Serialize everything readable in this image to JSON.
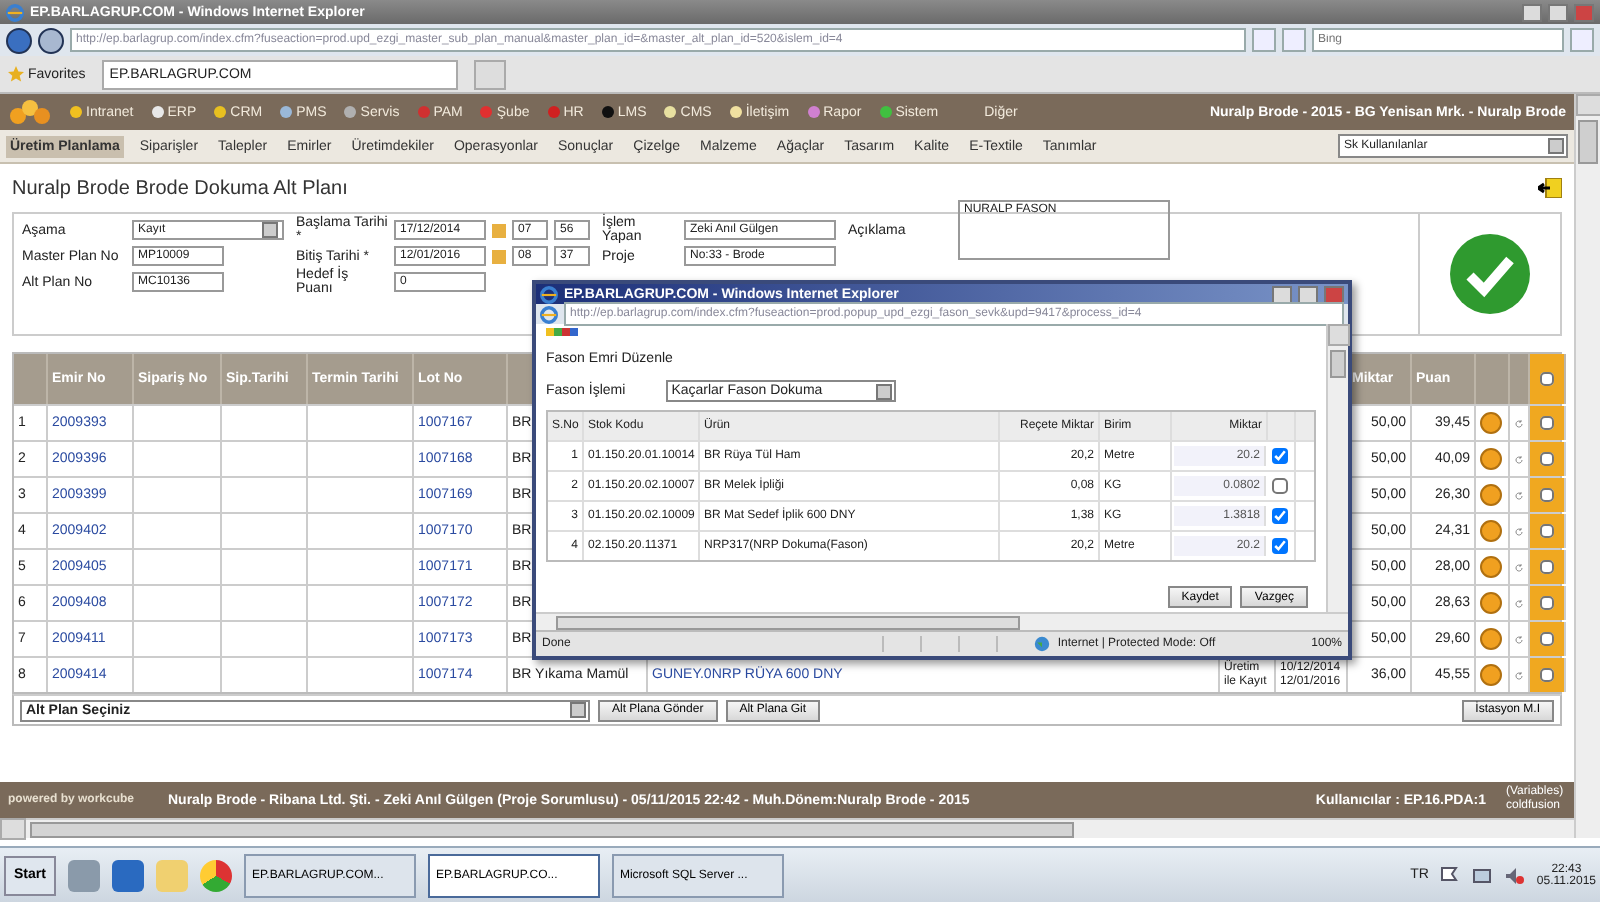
{
  "browser": {
    "title": "EP.BARLAGRUP.COM - Windows Internet Explorer",
    "url": "http://ep.barlagrup.com/index.cfm?fuseaction=prod.upd_ezgi_master_sub_plan_manual&master_plan_id=&master_alt_plan_id=520&islem_id=4",
    "search_placeholder": "Bing",
    "favorites": "Favorites",
    "tab": "EP.BARLAGRUP.COM"
  },
  "modules": [
    {
      "label": "Intranet",
      "color": "#f0c020"
    },
    {
      "label": "ERP",
      "color": "#e8e8e8"
    },
    {
      "label": "CRM",
      "color": "#e8c020"
    },
    {
      "label": "PMS",
      "color": "#9ab8d8"
    },
    {
      "label": "Servis",
      "color": "#b0b0b0"
    },
    {
      "label": "PAM",
      "color": "#d03030"
    },
    {
      "label": "Şube",
      "color": "#e03030"
    },
    {
      "label": "HR",
      "color": "#d02020"
    },
    {
      "label": "LMS",
      "color": "#101010"
    },
    {
      "label": "CMS",
      "color": "#e8e0a0"
    },
    {
      "label": "İletişim",
      "color": "#f0e0a0"
    },
    {
      "label": "Rapor",
      "color": "#d080d0"
    },
    {
      "label": "Sistem",
      "color": "#40c040"
    }
  ],
  "module_more": "Diğer",
  "session": "Nuralp Brode - 2015 - BG Yenisan Mrk. - Nuralp Brode",
  "menu": [
    {
      "label": "Üretim Planlama",
      "selected": true
    },
    {
      "label": "Siparişler",
      "selected": false
    },
    {
      "label": "Talepler",
      "selected": false
    },
    {
      "label": "Emirler",
      "selected": false
    },
    {
      "label": "Üretimdekiler",
      "selected": false
    },
    {
      "label": "Operasyonlar",
      "selected": false
    },
    {
      "label": "Sonuçlar",
      "selected": false
    },
    {
      "label": "Çizelge",
      "selected": false
    },
    {
      "label": "Malzeme",
      "selected": false
    },
    {
      "label": "Ağaçlar",
      "selected": false
    },
    {
      "label": "Tasarım",
      "selected": false
    },
    {
      "label": "Kalite",
      "selected": false
    },
    {
      "label": "E-Textile",
      "selected": false
    },
    {
      "label": "Tanımlar",
      "selected": false
    }
  ],
  "quick_select": "Sk Kullanılanlar",
  "page_title": "Nuralp Brode Brode Dokuma Alt Planı",
  "form": {
    "columns": [
      [
        {
          "kind": "select",
          "label": "Aşama",
          "value": "Kayıt"
        },
        {
          "kind": "text",
          "label": "Master Plan No",
          "value": "MP10009"
        },
        {
          "kind": "text",
          "label": "Alt Plan No",
          "value": "MC10136"
        }
      ],
      [
        {
          "kind": "datetime",
          "label": "Başlama Tarihi *",
          "value": "17/12/2014",
          "hour": "07",
          "minute": "56"
        },
        {
          "kind": "datetime",
          "label": "Bitiş Tarihi *",
          "value": "12/01/2016",
          "hour": "08",
          "minute": "37"
        },
        {
          "kind": "text",
          "label": "Hedef İş Puanı",
          "value": "0"
        }
      ],
      [
        {
          "kind": "text",
          "label": "İşlem Yapan",
          "value": "Zeki Anıl Gülgen"
        },
        {
          "kind": "text",
          "label": "Proje",
          "value": "No:33 - Brode"
        }
      ],
      [
        {
          "kind": "textarea",
          "label": "Açıklama",
          "value": "NURALP FASON"
        }
      ]
    ]
  },
  "table": {
    "columns": {
      "emir_no": "Emir No",
      "siparis_no": "Sipariş No",
      "sip_tarihi": "Sip.Tarihi",
      "termin_tarihi": "Termin Tarihi",
      "lot_no": "Lot No",
      "miktar": "Miktar",
      "puan": "Puan"
    },
    "select_all_checked": false,
    "rows": [
      {
        "no": "1",
        "emir_no": "2009393",
        "lot_no": "1007167",
        "urun": "BR",
        "miktar": "50,00",
        "puan": "39,45",
        "checked": false
      },
      {
        "no": "2",
        "emir_no": "2009396",
        "lot_no": "1007168",
        "urun": "BR",
        "miktar": "50,00",
        "puan": "40,09",
        "checked": false
      },
      {
        "no": "3",
        "emir_no": "2009399",
        "lot_no": "1007169",
        "urun": "BR",
        "miktar": "50,00",
        "puan": "26,30",
        "checked": false
      },
      {
        "no": "4",
        "emir_no": "2009402",
        "lot_no": "1007170",
        "urun": "BR",
        "miktar": "50,00",
        "puan": "24,31",
        "checked": false
      },
      {
        "no": "5",
        "emir_no": "2009405",
        "lot_no": "1007171",
        "urun": "BR",
        "miktar": "50,00",
        "puan": "28,00",
        "checked": false
      },
      {
        "no": "6",
        "emir_no": "2009408",
        "lot_no": "1007172",
        "urun": "BR",
        "miktar": "50,00",
        "puan": "28,63",
        "checked": false
      },
      {
        "no": "7",
        "emir_no": "2009411",
        "lot_no": "1007173",
        "urun": "BR",
        "miktar": "50,00",
        "puan": "29,60",
        "checked": false
      },
      {
        "no": "8",
        "emir_no": "2009414",
        "lot_no": "1007174",
        "urun": "BR Yıkama Mamül",
        "column_8": "GUNEY.0NRP RÜYA 600 DNY",
        "asama": "Üretim ile Kayıt",
        "tarih": "10/12/2014 12/01/2016",
        "miktar": "36,00",
        "puan": "45,55",
        "checked": false
      }
    ]
  },
  "actions": {
    "alt_plan_select": "Alt Plan Seçiniz",
    "buttons": [
      "Alt Plana Gönder",
      "Alt Plana Git"
    ],
    "station_button": "İstasyon M.I"
  },
  "footer": {
    "powered": "powered by workcube",
    "info": "Nuralp Brode - Ribana Ltd. Şti. - Zeki Anıl Gülgen (Proje Sorumlusu) - 05/11/2015 22:42 - Muh.Dönem:Nuralp Brode - 2015",
    "users": "Kullanıcılar : EP.16.PDA:1",
    "variables": "(Variables)",
    "server": "coldfusion"
  },
  "popup": {
    "title": "EP.BARLAGRUP.COM - Windows Internet Explorer",
    "url": "http://ep.barlagrup.com/index.cfm?fuseaction=prod.popup_upd_ezgi_fason_sevk&upd=9417&process_id=4",
    "heading": "Fason Emri Düzenle",
    "process_label": "Fason İşlemi",
    "process_value": "Kaçarlar Fason Dokuma",
    "columns": [
      "S.No",
      "Stok Kodu",
      "Ürün",
      "Reçete Miktar",
      "Birim",
      "Miktar"
    ],
    "rows": [
      {
        "no": "1",
        "stok_kodu": "01.150.20.01.10014",
        "urun": "BR Rüya Tül Ham",
        "recete_miktar": "20,2",
        "birim": "Metre",
        "miktar": "20.2",
        "checked": true
      },
      {
        "no": "2",
        "stok_kodu": "01.150.20.02.10007",
        "urun": "BR Melek İpliği",
        "recete_miktar": "0,08",
        "birim": "KG",
        "miktar": "0.0802",
        "checked": false
      },
      {
        "no": "3",
        "stok_kodu": "01.150.20.02.10009",
        "urun": "BR Mat Sedef İplik 600 DNY",
        "recete_miktar": "1,38",
        "birim": "KG",
        "miktar": "1.3818",
        "checked": true
      },
      {
        "no": "4",
        "stok_kodu": "02.150.20.11371",
        "urun": "NRP317(NRP Dokuma(Fason)",
        "recete_miktar": "20,2",
        "birim": "Metre",
        "miktar": "20.2",
        "checked": true
      }
    ],
    "buttons": [
      "Kaydet",
      "Vazgeç"
    ],
    "status": "Done",
    "zone": "Internet | Protected Mode: Off",
    "zoom": "100%"
  },
  "taskbar": {
    "start": "Start",
    "tasks": [
      {
        "label": "EP.BARLAGRUP.COM...",
        "selected": false
      },
      {
        "label": "EP.BARLAGRUP.CO...",
        "selected": true
      },
      {
        "label": "Microsoft SQL Server ...",
        "selected": false
      }
    ],
    "language": "TR",
    "time": "22:43",
    "date": "05.11.2015"
  }
}
